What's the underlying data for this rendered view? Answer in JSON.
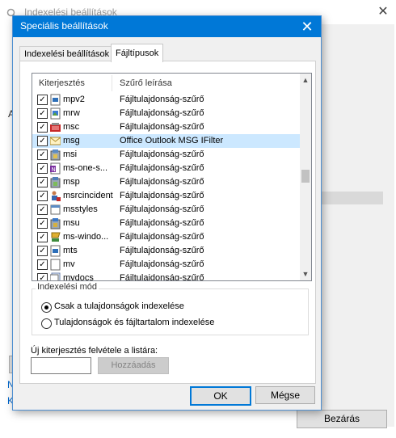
{
  "background_window": {
    "title": "Indexelési beállítások",
    "close_symbol": "✕",
    "left_fragments": [
      "A",
      "N",
      "K"
    ],
    "close_button": "Bezárás"
  },
  "dialog": {
    "title": "Speciális beállítások",
    "close_symbol": "✕",
    "tabs": [
      {
        "label": "Indexelési beállítások",
        "active": false
      },
      {
        "label": "Fájltípusok",
        "active": true
      }
    ],
    "list": {
      "columns": [
        "Kiterjesztés",
        "Szűrő leírása"
      ],
      "rows": [
        {
          "ext": "mpv2",
          "filter": "Fájltulajdonság-szűrő",
          "checked": true,
          "icon": "video-file-icon"
        },
        {
          "ext": "mrw",
          "filter": "Fájltulajdonság-szűrő",
          "checked": true,
          "icon": "image-file-icon"
        },
        {
          "ext": "msc",
          "filter": "Fájltulajdonság-szűrő",
          "checked": true,
          "icon": "management-console-icon"
        },
        {
          "ext": "msg",
          "filter": "Office Outlook MSG IFilter",
          "checked": true,
          "icon": "mail-message-icon",
          "selected": true
        },
        {
          "ext": "msi",
          "filter": "Fájltulajdonság-szűrő",
          "checked": true,
          "icon": "installer-package-icon"
        },
        {
          "ext": "ms-one-s...",
          "filter": "Fájltulajdonság-szűrő",
          "checked": true,
          "icon": "onenote-file-icon"
        },
        {
          "ext": "msp",
          "filter": "Fájltulajdonság-szűrő",
          "checked": true,
          "icon": "installer-patch-icon"
        },
        {
          "ext": "msrcincident",
          "filter": "Fájltulajdonság-szűrő",
          "checked": true,
          "icon": "remote-assistance-icon"
        },
        {
          "ext": "msstyles",
          "filter": "Fájltulajdonság-szűrő",
          "checked": true,
          "icon": "visual-style-icon"
        },
        {
          "ext": "msu",
          "filter": "Fájltulajdonság-szűrő",
          "checked": true,
          "icon": "update-package-icon"
        },
        {
          "ext": "ms-windo...",
          "filter": "Fájltulajdonság-szűrő",
          "checked": true,
          "icon": "windows-store-icon"
        },
        {
          "ext": "mts",
          "filter": "Fájltulajdonság-szűrő",
          "checked": true,
          "icon": "video-file-icon"
        },
        {
          "ext": "mv",
          "filter": "Fájltulajdonság-szűrő",
          "checked": true,
          "icon": "generic-file-icon"
        },
        {
          "ext": "mydocs",
          "filter": "Fájltulajdonság-szűrő",
          "checked": true,
          "icon": "documents-icon"
        }
      ]
    },
    "index_mode": {
      "label": "Indexelési mód",
      "options": [
        {
          "label": "Csak a tulajdonságok indexelése",
          "selected": true
        },
        {
          "label": "Tulajdonságok és fájltartalom indexelése",
          "selected": false
        }
      ]
    },
    "new_extension": {
      "label": "Új kiterjesztés felvétele a listára:",
      "value": "",
      "add_button": "Hozzáadás"
    },
    "ok_button": "OK",
    "cancel_button": "Mégse"
  },
  "colors": {
    "titlebar": "#0078d7",
    "selection": "#cce8ff",
    "dialog_bg": "#f0f0f0"
  }
}
